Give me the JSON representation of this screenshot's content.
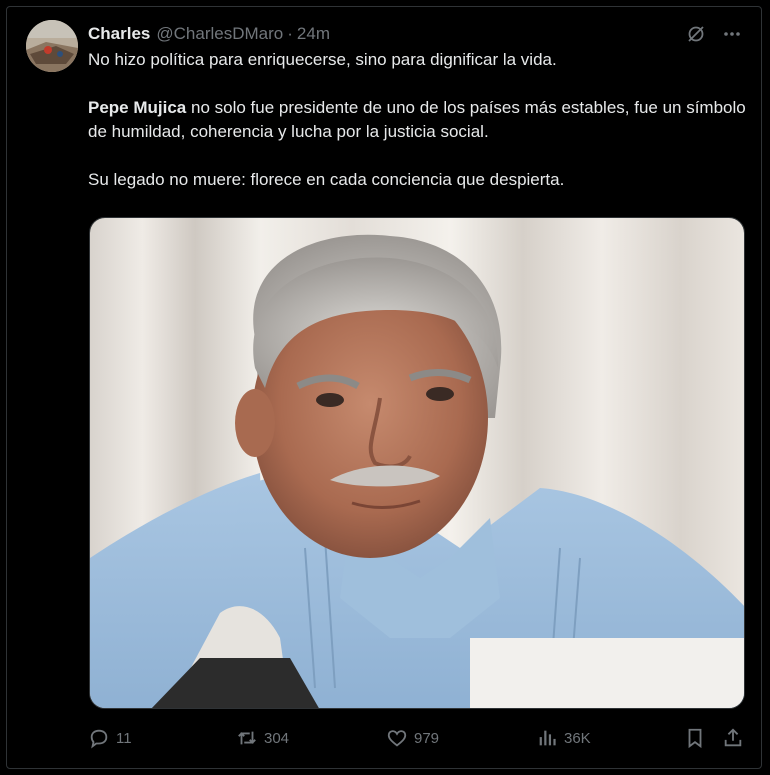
{
  "tweet": {
    "author_name": "Charles",
    "author_handle": "@CharlesDMaro",
    "separator": "·",
    "time": "24m",
    "line1": "No hizo política para enriquecerse, sino para dignificar la vida.",
    "para2_bold": "Pepe Mujica",
    "para2_rest": " no solo fue presidente de uno de los países más estables, fue un símbolo de humildad, coherencia y lucha por la justicia social.",
    "para3": "Su legado no muere: florece en cada conciencia que despierta."
  },
  "header_icons": [
    "grok-icon",
    "more-icon"
  ],
  "actions": {
    "replies": "11",
    "reposts": "304",
    "likes": "979",
    "views": "36K"
  },
  "colors": {
    "background": "#000000",
    "text": "#e7e9ea",
    "secondary": "#71767b",
    "border": "#2f3336"
  }
}
